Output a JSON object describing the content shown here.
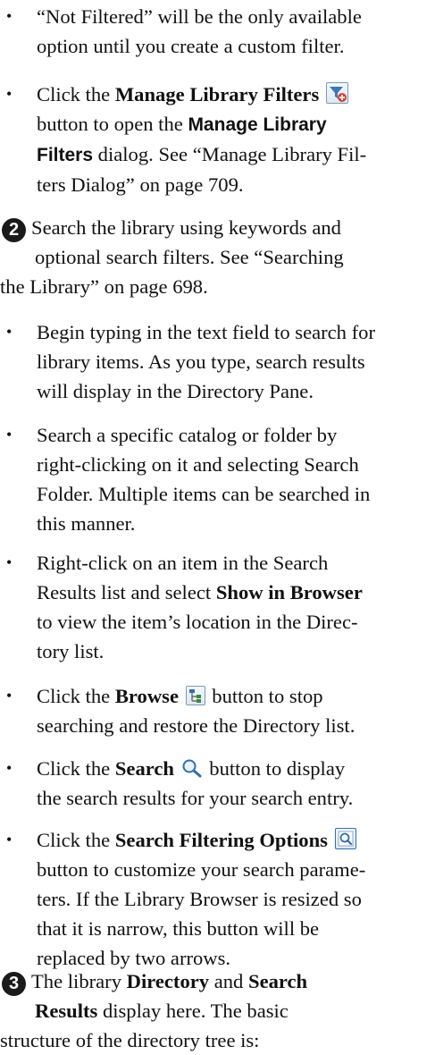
{
  "bullet_char": "•",
  "items": {
    "b1": {
      "l1": "“Not Filtered” will be the only available",
      "l2": "option until you create a custom filter."
    },
    "b2": {
      "a": "Click the ",
      "b": "Manage Library Filters",
      "icon": "manage-filters-icon",
      "c": "button to open the ",
      "d": "Manage Library",
      "e": "Filters",
      "f": " dialog. See “Manage Library Fil-",
      "g": "ters Dialog” on page 709."
    },
    "s2": {
      "num": "2",
      "l1": "Search the library using keywords and",
      "l2": "optional search filters. See “Searching",
      "l3": "the Library” on page 698."
    },
    "b3": {
      "l1": "Begin typing in the text field to search for",
      "l2": "library items. As you type, search results",
      "l3": "will display in the Directory Pane."
    },
    "b4": {
      "l1": "Search a specific catalog or folder by",
      "l2": "right-clicking on it and selecting Search",
      "l3": "Folder. Multiple items can be searched in",
      "l4": "this manner."
    },
    "b5": {
      "l1": "Right-click on an item in the Search",
      "l2a": "Results list and select ",
      "l2b": "Show in Browser",
      "l3": "to view the item’s location in the Direc-",
      "l4": "tory list."
    },
    "b6": {
      "a": "Click the ",
      "b": "Browse",
      "icon": "browse-icon",
      "c": " button to stop",
      "l2": "searching and restore the Directory list."
    },
    "b7": {
      "a": "Click the ",
      "b": "Search",
      "icon": "search-icon",
      "c": " button to display",
      "l2": "the search results for your search entry."
    },
    "b8": {
      "a": "Click the ",
      "b": "Search Filtering Options",
      "icon": "search-filter-options-icon",
      "l2": "button to customize your search parame-",
      "l3": "ters. If the Library Browser is resized so",
      "l4": "that it is narrow, this button will be",
      "l5": "replaced by two arrows."
    },
    "s3": {
      "num": "3",
      "a": "The library ",
      "b": "Directory",
      "c": " and ",
      "d": "Search",
      "e": "Results",
      "f": " display here. The basic",
      "l3": "structure of the directory tree is:"
    }
  }
}
